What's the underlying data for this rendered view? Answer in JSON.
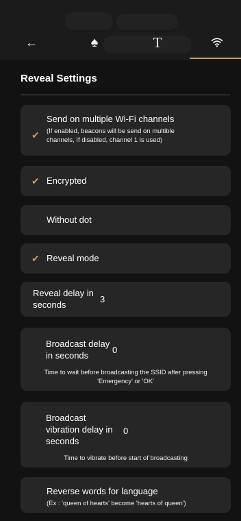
{
  "header": {
    "tabs": [
      {
        "icon": "arrow-left-icon",
        "glyph": "←"
      },
      {
        "icon": "spade-icon",
        "glyph": "♠"
      },
      {
        "icon": "text-t-icon",
        "glyph": "T"
      },
      {
        "icon": "wifi-icon",
        "glyph": ""
      }
    ],
    "active_tab": "wifi-icon",
    "accent_color": "#c49a6c"
  },
  "section": {
    "title": "Reveal Settings"
  },
  "settings": {
    "multi_channel": {
      "checked": true,
      "label": "Send on multiple Wi-Fi channels",
      "description_line1": "(If enabled, beacons will be send on multible",
      "description_line2": "channels, If disabled, channel 1 is used)"
    },
    "encrypted": {
      "checked": true,
      "label": "Encrypted"
    },
    "without_dot": {
      "checked": false,
      "label": "Without dot"
    },
    "reveal_mode": {
      "checked": true,
      "label": "Reveal mode"
    },
    "reveal_delay": {
      "label_line1": "Reveal delay in",
      "label_line2": "seconds",
      "value": "3"
    },
    "broadcast_delay": {
      "label_line1": "Broadcast delay",
      "label_line2": "in seconds",
      "value": "0",
      "help_line1": "Time to wait before broadcasting the SSID after pressing",
      "help_line2": "'Emergency' or 'OK'"
    },
    "vibration_delay": {
      "label_line1": "Broadcast",
      "label_line2": "vibration delay in",
      "label_line3": "seconds",
      "value": "0",
      "help": "Time to vibrate before start of broadcasting"
    },
    "reverse_words": {
      "label": "Reverse words for language",
      "description": "(Ex : 'queen of hearts' become 'hearts of queen')"
    }
  },
  "colors": {
    "check": "#d39a5f",
    "card": "#262626",
    "background": "#121212"
  }
}
